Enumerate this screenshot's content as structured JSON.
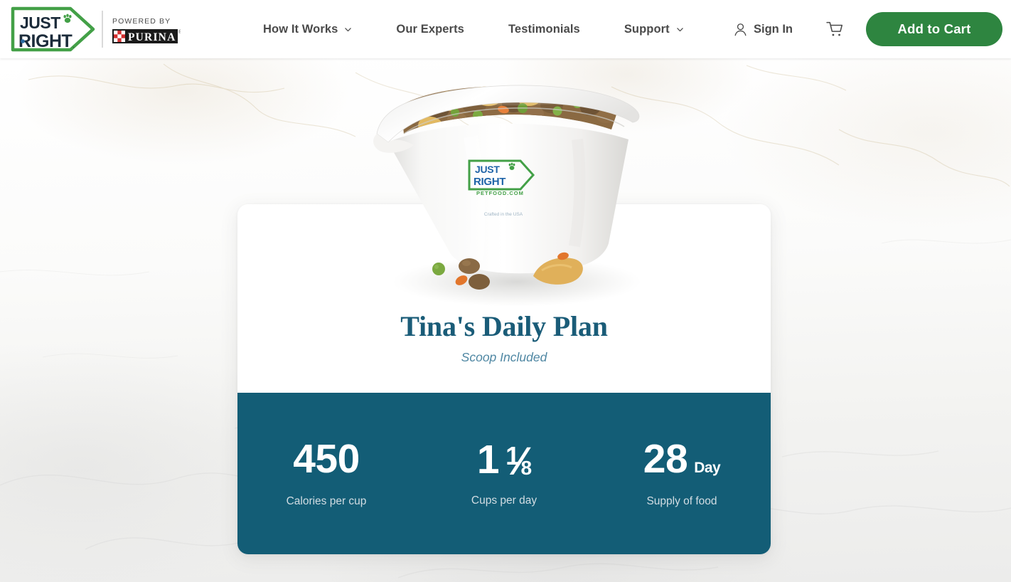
{
  "header": {
    "logo": {
      "brand_line1": "JUST",
      "brand_line2": "RIGHT",
      "powered_by": "POWERED BY",
      "partner": "PURINA"
    },
    "nav": [
      {
        "label": "How It Works",
        "has_dropdown": true
      },
      {
        "label": "Our Experts",
        "has_dropdown": false
      },
      {
        "label": "Testimonials",
        "has_dropdown": false
      },
      {
        "label": "Support",
        "has_dropdown": true
      }
    ],
    "sign_in_label": "Sign In",
    "cart_icon": "shopping-cart-icon",
    "account_icon": "user-icon",
    "add_to_cart_label": "Add to Cart"
  },
  "product_image": {
    "alt": "Just Right measuring scoop filled with dry dog food kibble",
    "scoop_logo_line1": "JUST",
    "scoop_logo_line2": "RIGHT",
    "scoop_logo_url": "PETFOOD.COM",
    "scoop_tagline": "Crafted in the USA"
  },
  "plan_card": {
    "title": "Tina's Daily Plan",
    "subtitle": "Scoop Included",
    "stats": [
      {
        "id": "calories",
        "value": "450",
        "unit": "",
        "label": "Calories per cup"
      },
      {
        "id": "cups",
        "value": "1",
        "fraction": {
          "numerator": "1",
          "denominator": "8"
        },
        "unit": "",
        "label": "Cups per day"
      },
      {
        "id": "supply",
        "value": "28",
        "unit": "Day",
        "label": "Supply of food"
      }
    ]
  },
  "colors": {
    "brand_green": "#2E8540",
    "brand_teal": "#135D76",
    "title_teal": "#1A5C78",
    "subtitle_blue": "#4F87A3",
    "stat_label": "#D2DDE3",
    "nav_text": "#4A4A4A",
    "page_background": "#F2F2F0"
  }
}
